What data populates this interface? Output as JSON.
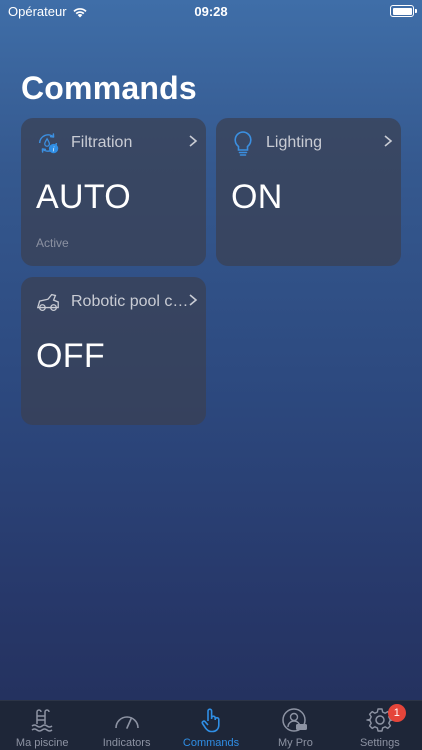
{
  "status_bar": {
    "carrier": "Opérateur",
    "time": "09:28"
  },
  "page": {
    "title": "Commands"
  },
  "cards": [
    {
      "title": "Filtration",
      "value": "AUTO",
      "subtitle": "Active",
      "icon": "filtration-icon"
    },
    {
      "title": "Lighting",
      "value": "ON",
      "icon": "bulb-icon"
    },
    {
      "title": "Robotic pool cl...",
      "value": "OFF",
      "icon": "robot-cleaner-icon"
    }
  ],
  "tabbar": {
    "tabs": [
      {
        "label": "Ma piscine",
        "icon": "pool-icon"
      },
      {
        "label": "Indicators",
        "icon": "gauge-icon"
      },
      {
        "label": "Commands",
        "icon": "hand-pointer-icon",
        "active": true
      },
      {
        "label": "My Pro",
        "icon": "pro-icon"
      },
      {
        "label": "Settings",
        "icon": "gear-icon",
        "badge": "1"
      }
    ]
  },
  "colors": {
    "accent": "#2f8ee5",
    "badge": "#e5453a",
    "card": "#3a4052"
  }
}
